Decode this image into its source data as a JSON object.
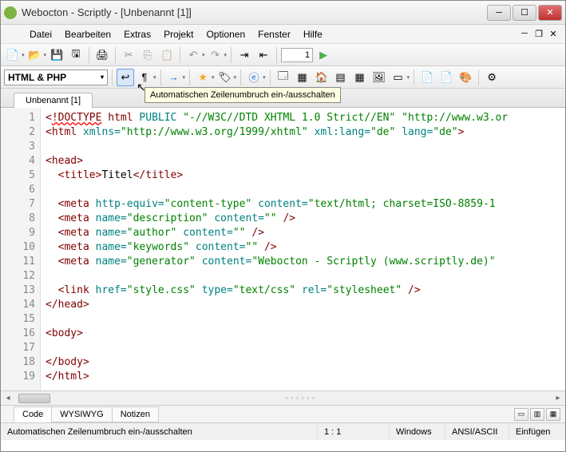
{
  "window": {
    "title": "Webocton - Scriptly - [Unbenannt [1]]"
  },
  "menu": {
    "items": [
      "Datei",
      "Bearbeiten",
      "Extras",
      "Projekt",
      "Optionen",
      "Fenster",
      "Hilfe"
    ]
  },
  "toolbar1": {
    "goto_value": "1"
  },
  "toolbar2": {
    "lang": "HTML & PHP",
    "tooltip": "Automatischen Zeilenumbruch ein-/ausschalten"
  },
  "tabs": {
    "file": "Unbenannt [1]"
  },
  "code": {
    "lines": [
      {
        "n": 1,
        "html": "<span class='t-tag'>&lt;</span><span class='t-doctype'>!DOCTYPE</span> <span class='t-tag'>html</span> <span class='t-attr'>PUBLIC</span> <span class='t-str'>\"-//W3C//DTD XHTML 1.0 Strict//EN\" \"http://www.w3.or</span>"
      },
      {
        "n": 2,
        "html": "<span class='t-tag'>&lt;html</span> <span class='t-attr'>xmlns=</span><span class='t-str'>\"http://www.w3.org/1999/xhtml\"</span> <span class='t-attr'>xml:lang=</span><span class='t-str'>\"de\"</span> <span class='t-attr'>lang=</span><span class='t-str'>\"de\"</span><span class='t-tag'>&gt;</span>"
      },
      {
        "n": 3,
        "html": ""
      },
      {
        "n": 4,
        "html": "<span class='t-tag'>&lt;head&gt;</span>"
      },
      {
        "n": 5,
        "html": "  <span class='t-tag'>&lt;title&gt;</span>Titel<span class='t-tag'>&lt;/title&gt;</span>"
      },
      {
        "n": 6,
        "html": ""
      },
      {
        "n": 7,
        "html": "  <span class='t-tag'>&lt;meta</span> <span class='t-attr'>http-equiv=</span><span class='t-str'>\"content-type\"</span> <span class='t-attr'>content=</span><span class='t-str'>\"text/html; charset=ISO-8859-1</span>"
      },
      {
        "n": 8,
        "html": "  <span class='t-tag'>&lt;meta</span> <span class='t-attr'>name=</span><span class='t-str'>\"description\"</span> <span class='t-attr'>content=</span><span class='t-str'>\"\"</span> <span class='t-tag'>/&gt;</span>"
      },
      {
        "n": 9,
        "html": "  <span class='t-tag'>&lt;meta</span> <span class='t-attr'>name=</span><span class='t-str'>\"author\"</span> <span class='t-attr'>content=</span><span class='t-str'>\"\"</span> <span class='t-tag'>/&gt;</span>"
      },
      {
        "n": 10,
        "html": "  <span class='t-tag'>&lt;meta</span> <span class='t-attr'>name=</span><span class='t-str'>\"keywords\"</span> <span class='t-attr'>content=</span><span class='t-str'>\"\"</span> <span class='t-tag'>/&gt;</span>"
      },
      {
        "n": 11,
        "html": "  <span class='t-tag'>&lt;meta</span> <span class='t-attr'>name=</span><span class='t-str'>\"generator\"</span> <span class='t-attr'>content=</span><span class='t-str'>\"Webocton - Scriptly (www.scriptly.de)\"</span>"
      },
      {
        "n": 12,
        "html": ""
      },
      {
        "n": 13,
        "html": "  <span class='t-tag'>&lt;link</span> <span class='t-attr'>href=</span><span class='t-str'>\"style.css\"</span> <span class='t-attr'>type=</span><span class='t-str'>\"text/css\"</span> <span class='t-attr'>rel=</span><span class='t-str'>\"stylesheet\"</span> <span class='t-tag'>/&gt;</span>"
      },
      {
        "n": 14,
        "html": "<span class='t-tag'>&lt;/head&gt;</span>"
      },
      {
        "n": 15,
        "html": ""
      },
      {
        "n": 16,
        "html": "<span class='t-tag'>&lt;body&gt;</span>"
      },
      {
        "n": 17,
        "html": ""
      },
      {
        "n": 18,
        "html": "<span class='t-tag'>&lt;/body&gt;</span>"
      },
      {
        "n": 19,
        "html": "<span class='t-tag'>&lt;/html&gt;</span>"
      }
    ]
  },
  "bottom_tabs": {
    "items": [
      "Code",
      "WYSIWYG",
      "Notizen"
    ],
    "active": 0
  },
  "status": {
    "hint": "Automatischen Zeilenumbruch ein-/ausschalten",
    "pos": "1 : 1",
    "os": "Windows",
    "enc": "ANSI/ASCII",
    "mode": "Einfügen"
  }
}
